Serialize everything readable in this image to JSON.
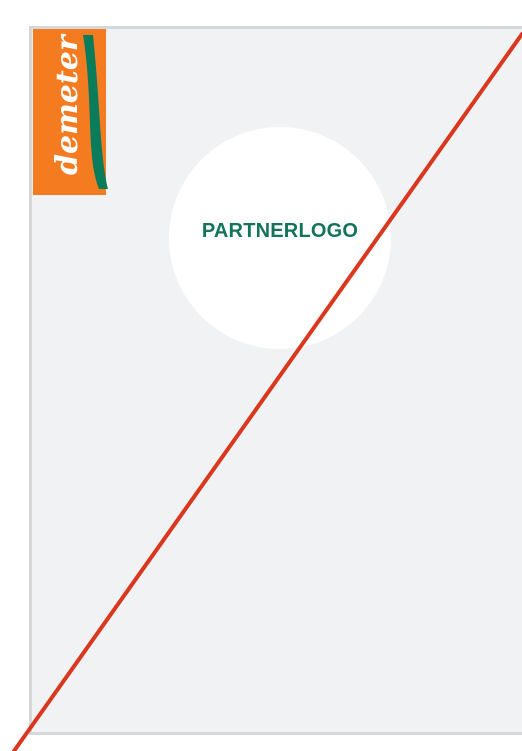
{
  "logo": {
    "wordmark": "demeter",
    "colors": {
      "orange": "#f47b20",
      "green": "#0a7c5c",
      "white": "#ffffff"
    }
  },
  "placeholder": {
    "label": "PARTNERLOGO",
    "label_color": "#14745a",
    "fill": "#ffffff"
  },
  "panel": {
    "background": "#f1f2f4",
    "border": "#d6d7d9"
  },
  "strike_line": {
    "color": "#d9381e"
  }
}
